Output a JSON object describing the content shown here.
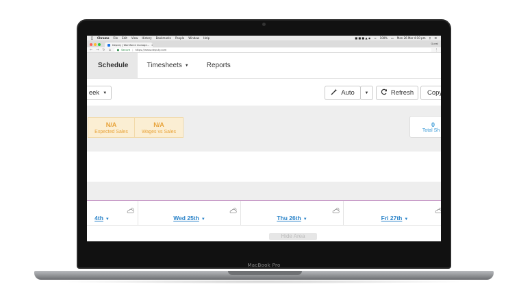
{
  "device": {
    "bezel_label": "MacBook Pro"
  },
  "menubar": {
    "app": "Chrome",
    "items": [
      "File",
      "Edit",
      "View",
      "History",
      "Bookmarks",
      "People",
      "Window",
      "Help"
    ],
    "battery": "100%",
    "clock": "Mon 26 Mar 4:10 pm"
  },
  "browser": {
    "tab_title": "Deputy | Workforce manage...",
    "tab_close": "×",
    "guest_label": "Guest",
    "secure_label": "Secure",
    "url": "https://www.deputy.com"
  },
  "nav": {
    "schedule": "Schedule",
    "timesheets": "Timesheets",
    "reports": "Reports"
  },
  "toolbar": {
    "week_label": "eek",
    "auto_label": "Auto",
    "refresh_label": "Refresh",
    "copy_label": "Copy"
  },
  "stats": {
    "expected_sales_value": "N/A",
    "expected_sales_label": "Expected Sales",
    "wages_value": "N/A",
    "wages_label": "Wages vs Sales",
    "total_value": "0",
    "total_label": "Total Sh"
  },
  "days": [
    {
      "label": "4th"
    },
    {
      "label": "Wed 25th"
    },
    {
      "label": "Thu 26th"
    },
    {
      "label": "Fri 27th"
    }
  ],
  "hide_area_label": "Hide Area",
  "colors": {
    "accent_blue": "#2a83c9",
    "stat_orange": "#e8a33a",
    "stat_bg": "#fbeed3"
  }
}
